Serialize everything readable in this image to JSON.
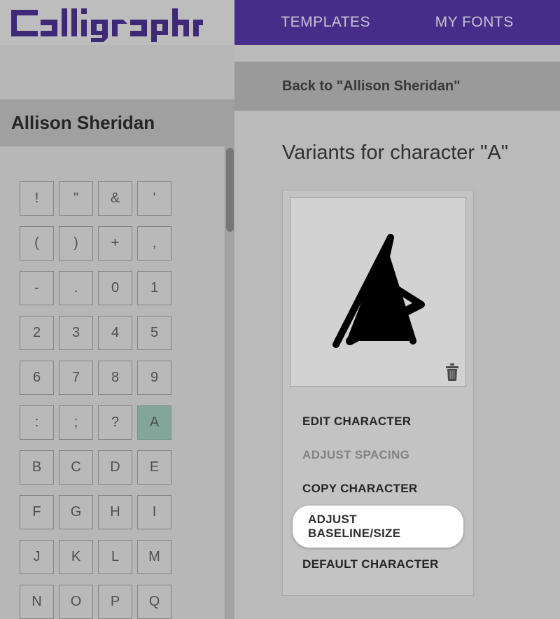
{
  "brand": {
    "name": "calligraphr"
  },
  "nav": {
    "templates": "TEMPLATES",
    "my_fonts": "MY FONTS"
  },
  "back_bar": {
    "label": "Back to \"Allison Sheridan\""
  },
  "sidebar": {
    "font_name": "Allison Sheridan",
    "chars": [
      "!",
      "\"",
      "&",
      "'",
      "(",
      ")",
      "+",
      ",",
      "-",
      ".",
      "0",
      "1",
      "2",
      "3",
      "4",
      "5",
      "6",
      "7",
      "8",
      "9",
      ":",
      ";",
      "?",
      "A",
      "B",
      "C",
      "D",
      "E",
      "F",
      "G",
      "H",
      "I",
      "J",
      "K",
      "L",
      "M",
      "N",
      "O",
      "P",
      "Q"
    ],
    "selected_index": 23
  },
  "main": {
    "title": "Variants for character \"A\"",
    "actions": {
      "edit": "EDIT CHARACTER",
      "adjust_spacing": "ADJUST SPACING",
      "copy": "COPY CHARACTER",
      "adjust_baseline": "ADJUST BASELINE/SIZE",
      "default_char": "DEFAULT CHARACTER"
    }
  }
}
